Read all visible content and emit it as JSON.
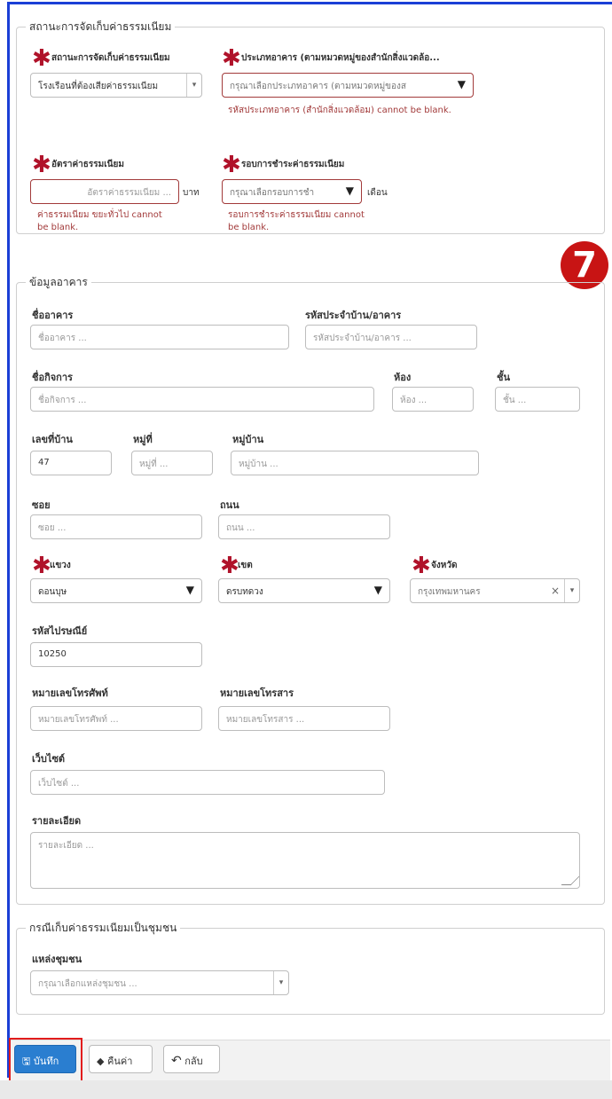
{
  "fee_section": {
    "legend": "สถานะการจัดเก็บค่าธรรมเนียม",
    "status_label": "สถานะการจัดเก็บค่าธรรมเนียม",
    "status_value": "โรงเรือนที่ต้องเสียค่าธรรมเนียม",
    "building_type_label": "ประเภทอาคาร (ตามหมวดหมู่ของสำนักสิ่งแวดล้อ...",
    "building_type_placeholder": "กรุณาเลือกประเภทอาคาร (ตามหมวดหมู่ของส",
    "building_type_error": "รหัสประเภทอาคาร (สำนักสิ่งแวดล้อม) cannot be blank.",
    "fee_rate_label": "อัตราค่าธรรมเนียม",
    "fee_rate_placeholder": "อัตราค่าธรรมเนียม ...",
    "fee_rate_unit": "บาท",
    "fee_rate_error": "ค่าธรรมเนียม ขยะทั่วไป cannot be blank.",
    "payment_cycle_label": "รอบการชำระค่าธรรมเนียม",
    "payment_cycle_placeholder": "กรุณาเลือกรอบการชำ",
    "payment_cycle_unit": "เดือน",
    "payment_cycle_error": "รอบการชำระค่าธรรมเนียม cannot be blank."
  },
  "building_section": {
    "legend": "ข้อมูลอาคาร",
    "building_name_label": "ชื่ออาคาร",
    "building_name_placeholder": "ชื่ออาคาร ...",
    "house_code_label": "รหัสประจำบ้าน/อาคาร",
    "house_code_placeholder": "รหัสประจำบ้าน/อาคาร ...",
    "business_name_label": "ชื่อกิจการ",
    "business_name_placeholder": "ชื่อกิจการ ...",
    "room_label": "ห้อง",
    "room_placeholder": "ห้อง ...",
    "floor_label": "ชั้น",
    "floor_placeholder": "ชั้น ...",
    "house_no_label": "เลขที่บ้าน",
    "house_no_value": "47",
    "moo_label": "หมู่ที่",
    "moo_placeholder": "หมู่ที่ ...",
    "village_label": "หมู่บ้าน",
    "village_placeholder": "หมู่บ้าน ...",
    "soi_label": "ซอย",
    "soi_placeholder": "ซอย ...",
    "road_label": "ถนน",
    "road_placeholder": "ถนน ...",
    "subdistrict_label": "แขวง",
    "subdistrict_value": "ดอนบุษ",
    "district_label": "เขต",
    "district_value": "ดรบทดวง",
    "province_label": "จังหวัด",
    "province_value": "กรุงเทพมหานคร",
    "postcode_label": "รหัสไปรษณีย์",
    "postcode_value": "10250",
    "phone_label": "หมายเลขโทรศัพท์",
    "phone_placeholder": "หมายเลขโทรศัพท์ ...",
    "fax_label": "หมายเลขโทรสาร",
    "fax_placeholder": "หมายเลขโทรสาร ...",
    "website_label": "เว็บไซต์",
    "website_placeholder": "เว็บไซต์ ...",
    "details_label": "รายละเอียด",
    "details_placeholder": "รายละเอียด ..."
  },
  "community_section": {
    "legend": "กรณีเก็บค่าธรรมเนียมเป็นชุมชน",
    "community_label": "แหล่งชุมชน",
    "community_placeholder": "กรุณาเลือกแหล่งชุมชน ..."
  },
  "step_badge": "7",
  "buttons": {
    "save": "บันทึก",
    "reset": "คืนค่า",
    "back": "กลับ"
  },
  "icons": {
    "required": "✱",
    "dropdown_arrow": "▼",
    "clear": "×",
    "caret": "▾",
    "save_icon": "🖫",
    "reset_icon": "◆",
    "back_icon": "↶"
  },
  "colors": {
    "error": "#a23a3a",
    "primary": "#2a7ed0",
    "frame": "#1a3fd6",
    "highlight": "#e21c1c",
    "badge": "#c81414"
  }
}
